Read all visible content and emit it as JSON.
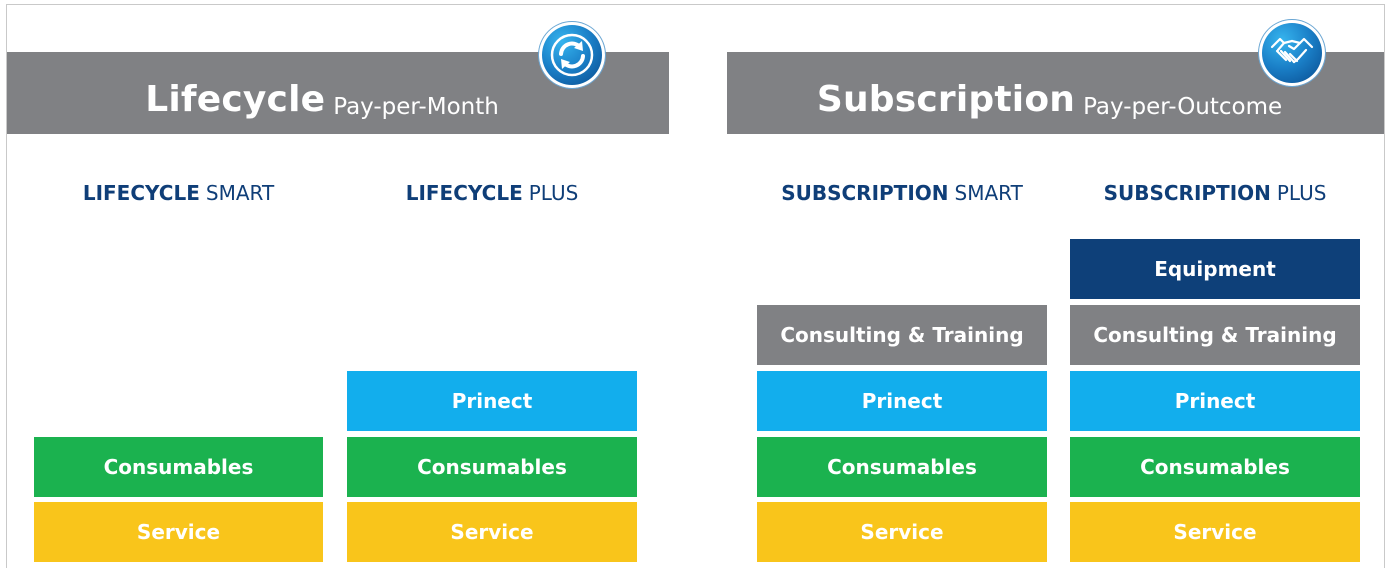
{
  "sections": [
    {
      "title_main": "Lifecycle",
      "title_sub": "Pay-per-Month",
      "badge_icon": "refresh-icon",
      "columns": [
        {
          "head_bold": "LIFECYCLE",
          "head_rest": "SMART",
          "items": [
            "Consumables",
            "Service"
          ]
        },
        {
          "head_bold": "LIFECYCLE",
          "head_rest": "PLUS",
          "items": [
            "Prinect",
            "Consumables",
            "Service"
          ]
        }
      ]
    },
    {
      "title_main": "Subscription",
      "title_sub": "Pay-per-Outcome",
      "badge_icon": "handshake-icon",
      "columns": [
        {
          "head_bold": "SUBSCRIPTION",
          "head_rest": "SMART",
          "items": [
            "Consulting & Training",
            "Prinect",
            "Consumables",
            "Service"
          ]
        },
        {
          "head_bold": "SUBSCRIPTION",
          "head_rest": "PLUS",
          "items": [
            "Equipment",
            "Consulting & Training",
            "Prinect",
            "Consumables",
            "Service"
          ]
        }
      ]
    }
  ],
  "colors": {
    "banner": "#808184",
    "heading": "#0f3e78",
    "service": "#f9c51b",
    "consumables": "#1bb24f",
    "prinect": "#12aeed",
    "consulting": "#808184",
    "equipment": "#0e4079"
  }
}
